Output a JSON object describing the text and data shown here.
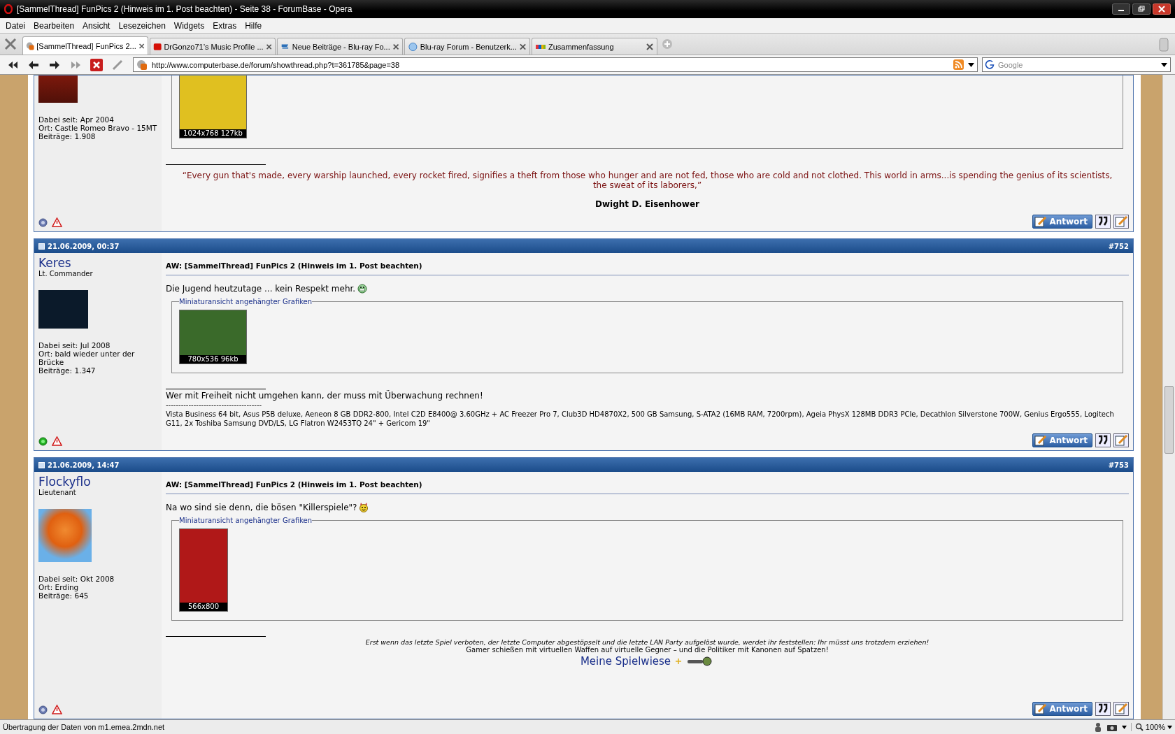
{
  "window": {
    "title": "[SammelThread] FunPics 2 (Hinweis im 1. Post beachten) - Seite 38 - ForumBase - Opera"
  },
  "menu": [
    "Datei",
    "Bearbeiten",
    "Ansicht",
    "Lesezeichen",
    "Widgets",
    "Extras",
    "Hilfe"
  ],
  "tabs": [
    {
      "label": "[SammelThread] FunPics 2...",
      "selected": true
    },
    {
      "label": "DrGonzo71’s Music Profile ...",
      "selected": false
    },
    {
      "label": "Neue Beiträge - Blu-ray Fo...",
      "selected": false
    },
    {
      "label": "Blu-ray Forum - Benutzerk...",
      "selected": false
    },
    {
      "label": "Zusammenfassung",
      "selected": false
    }
  ],
  "address_bar": {
    "url": "http://www.computerbase.de/forum/showthread.php?t=361785&page=38"
  },
  "search": {
    "placeholder": "Google"
  },
  "posts": [
    {
      "join": "Dabei seit: Apr 2004",
      "location": "Ort: Castle Romeo Bravo - 15MT",
      "post_count": "Beiträge: 1.908",
      "online": false,
      "thumbnail_caption": "1024x768 127kb",
      "signature": [
        {
          "kind": "quote",
          "text": "“Every gun that's made, every warship launched, every rocket fired, signifies a theft from those who hunger and are not fed, those who are cold and not clothed. This world in arms...is spending the genius of its scientists, the sweat of its laborers,”"
        },
        {
          "kind": "author",
          "text": "Dwight D. Eisenhower"
        }
      ],
      "reply_label": "Antwort"
    },
    {
      "date": "21.06.2009, 00:37",
      "number": "#752",
      "username": "Keres",
      "rank": "Lt. Commander",
      "join": "Dabei seit: Jul 2008",
      "location": "Ort: bald wieder unter der Brücke",
      "post_count": "Beiträge: 1.347",
      "online": true,
      "title": "AW: [SammelThread] FunPics 2 (Hinweis im 1. Post beachten)",
      "message": "Die Jugend heutzutage ... kein Respekt mehr.",
      "attachments_legend": "Miniaturansicht angehängter Grafiken",
      "thumbnail_caption": "780x536 96kb",
      "signature": [
        {
          "kind": "text",
          "text": "Wer mit Freiheit nicht umgehen kann, der muss mit Überwachung rechnen!"
        },
        {
          "kind": "small",
          "text": "--------------------------------------"
        },
        {
          "kind": "small",
          "text": "Vista Business 64 bit, Asus P5B deluxe, Aeneon 8 GB DDR2-800, Intel C2D E8400@ 3.60GHz + AC Freezer Pro 7, Club3D HD4870X2, 500 GB Samsung, S-ATA2 (16MB RAM, 7200rpm), Ageia PhysX 128MB DDR3 PCIe, Decathlon Silverstone 700W, Genius Ergo555, Logitech G11, 2x Toshiba Samsung DVD/LS, LG Flatron W2453TQ 24\" + Gericom 19\""
        }
      ],
      "reply_label": "Antwort"
    },
    {
      "date": "21.06.2009, 14:47",
      "number": "#753",
      "username": "Flockyflo",
      "rank": "Lieutenant",
      "join": "Dabei seit: Okt 2008",
      "location": "Ort: Erding",
      "post_count": "Beiträge: 645",
      "online": false,
      "title": "AW: [SammelThread] FunPics 2 (Hinweis im 1. Post beachten)",
      "message": "Na wo sind sie denn, die bösen \"Killerspiele\"?",
      "attachments_legend": "Miniaturansicht angehängter Grafiken",
      "thumbnail_caption": "566x800",
      "signature": [
        {
          "kind": "note-italic",
          "text": "Erst wenn das letzte Spiel verboten, der letzte Computer abgestöpselt und die letzte LAN Party aufgelöst wurde, werdet ihr feststellen: Ihr müsst uns trotzdem erziehen!"
        },
        {
          "kind": "note",
          "text": "Gamer schießen mit virtuellen Waffen auf virtuelle Gegner – und die Politiker mit Kanonen auf Spatzen!"
        },
        {
          "kind": "link",
          "text": "Meine Spielwiese"
        }
      ],
      "reply_label": "Antwort"
    }
  ],
  "status_bar": {
    "text": "Übertragung der Daten von m1.emea.2mdn.net",
    "zoom": "100%"
  }
}
